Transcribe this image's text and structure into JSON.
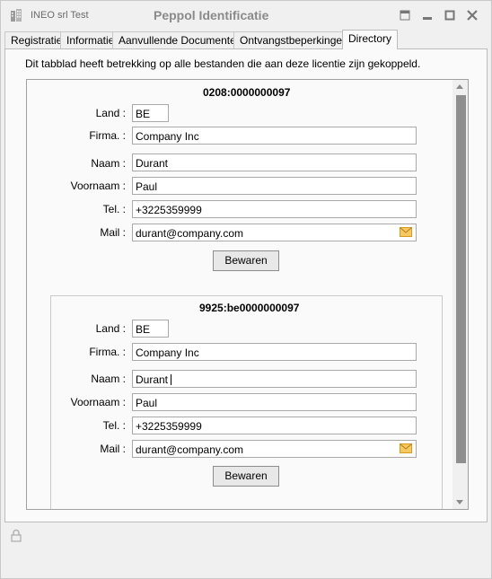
{
  "window": {
    "app_name": "INEO srl Test",
    "title": "Peppol Identificatie",
    "buttons": [
      "restore-icon",
      "minimize-icon",
      "maximize-icon",
      "close-icon"
    ]
  },
  "tabs": [
    {
      "label": "Registratie",
      "active": false
    },
    {
      "label": "Informatie",
      "active": false
    },
    {
      "label": "Aanvullende Documenten",
      "active": false
    },
    {
      "label": "Ontvangstbeperkingen",
      "active": false
    },
    {
      "label": "Directory",
      "active": true
    }
  ],
  "info_text": "Dit tabblad heeft betrekking op alle bestanden die aan deze licentie zijn gekoppeld.",
  "labels": {
    "land": "Land :",
    "firma": "Firma. :",
    "naam": "Naam :",
    "voornaam": "Voornaam :",
    "tel": "Tel. :",
    "mail": "Mail :"
  },
  "entries": [
    {
      "identifier": "0208:0000000097",
      "land": "BE",
      "firma": "Company Inc",
      "naam": "Durant",
      "voornaam": "Paul",
      "tel": "+3225359999",
      "mail": "durant@company.com",
      "save_label": "Bewaren"
    },
    {
      "identifier": "9925:be0000000097",
      "land": "BE",
      "firma": "Company Inc",
      "naam": "Durant",
      "voornaam": "Paul",
      "tel": "+3225359999",
      "mail": "durant@company.com",
      "save_label": "Bewaren"
    }
  ],
  "colors": {
    "background": "#f0f0f0",
    "panel": "#fafafa",
    "scroll_thumb": "#8f8f8f",
    "mail_icon": "#f0b63a"
  }
}
